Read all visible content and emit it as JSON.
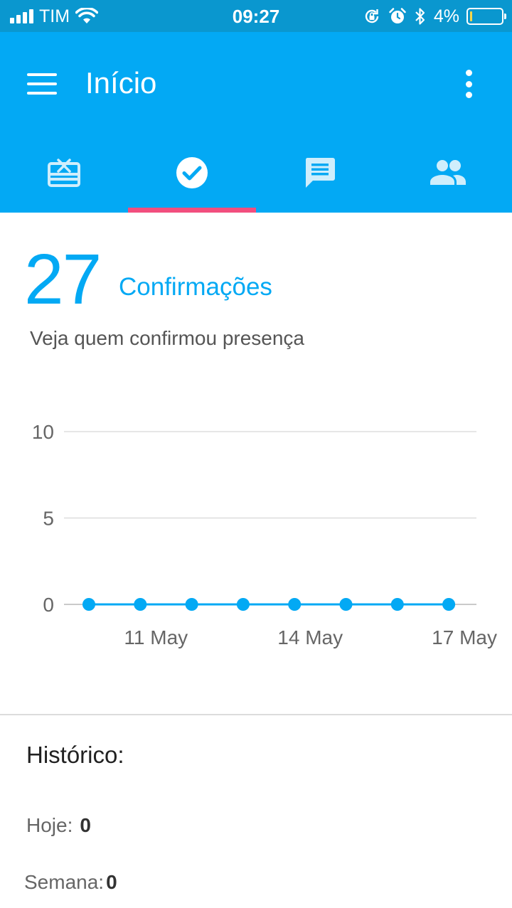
{
  "status_bar": {
    "carrier": "TIM",
    "time": "09:27",
    "battery_percent": "4%",
    "battery_level": 0.04,
    "signal_bars": 4,
    "icons": [
      "wifi-icon",
      "rotation-lock-icon",
      "alarm-icon",
      "bluetooth-icon",
      "battery-icon"
    ]
  },
  "app_bar": {
    "title": "Início",
    "color": "#03a9f4",
    "icons": [
      "menu-icon",
      "more-vert-icon"
    ]
  },
  "tabs": [
    {
      "icon": "gift-card-icon",
      "selected": false
    },
    {
      "icon": "check-circle-icon",
      "selected": true
    },
    {
      "icon": "message-icon",
      "selected": false
    },
    {
      "icon": "people-icon",
      "selected": false
    }
  ],
  "accent_color": "#f24e7e",
  "summary": {
    "count": "27",
    "label": "Confirmações",
    "subtitle": "Veja quem confirmou presença"
  },
  "chart_data": {
    "type": "line",
    "title": "",
    "xlabel": "",
    "ylabel": "",
    "x": [
      "10 May",
      "11 May",
      "12 May",
      "13 May",
      "14 May",
      "15 May",
      "16 May",
      "17 May"
    ],
    "series": [
      {
        "values": [
          0,
          0,
          0,
          0,
          0,
          0,
          0,
          0
        ]
      }
    ],
    "x_tick_labels": [
      "11 May",
      "14 May",
      "17 May"
    ],
    "y_ticks": [
      "0",
      "5",
      "10"
    ],
    "ylim": [
      0,
      10
    ],
    "grid": true,
    "legend": "none",
    "color": "#03a9f4"
  },
  "history": {
    "title": "Histórico:",
    "today_label": "Hoje:",
    "today_value": "0",
    "week_label": "Semana:",
    "week_value": "0"
  }
}
